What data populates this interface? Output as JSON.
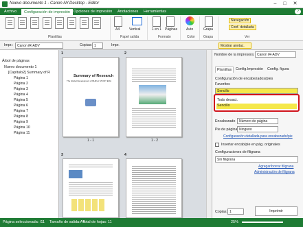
{
  "window": {
    "title": "Nuevo documento 1 - Canon iW Desktop - Editor",
    "minimize": "–",
    "maximize": "□",
    "close": "✕",
    "help": "?"
  },
  "ribbon_tabs": [
    "Archivo",
    "Configuración de impresión",
    "Opciones de impresión",
    "Anotaciones",
    "Herramientas"
  ],
  "ribbon": {
    "groups": {
      "plantillas": "Plantillas",
      "papel_salida": "Papel salida",
      "formato": "Formato",
      "color": "Color",
      "grapa": "Grapa",
      "ver": "Ver"
    },
    "paper_size": "A4",
    "orientation": "Vertical",
    "layout": "1 en 1",
    "order": "Páginas",
    "color_mode": "Auto",
    "staple": "Grapa",
    "navigation": "Navegación",
    "detailed_config": "Conf. detallada"
  },
  "toolbar2": {
    "printer_label": "Impr.:",
    "printer_value": "Canon iR-ADV",
    "copies_label": "Copias:",
    "copies_value": "1",
    "print_button": "Impr.",
    "zoom_label": "Mostrar anotac."
  },
  "tree": {
    "header": "Árbol de páginas",
    "root": "Nuevo documento 1",
    "chapter": "[Capítulo2] Summary of R",
    "pages": [
      "Página 1",
      "Página 2",
      "Página 3",
      "Página 4",
      "Página 5",
      "Página 6",
      "Página 7",
      "Página 8",
      "Página 9",
      "Página 10",
      "Página 11"
    ]
  },
  "pages": [
    {
      "num": "1",
      "caption": "1 - 1",
      "heading": "Summary of Research",
      "sub": "The Global Development of BHR at STUDY ERA"
    },
    {
      "num": "2",
      "caption": "1 - 2"
    },
    {
      "num": "3",
      "caption": ""
    },
    {
      "num": "4",
      "caption": ""
    }
  ],
  "right_panel": {
    "printer_label": "Nombre de la impresora:",
    "printer_value": "Canon iR-ADV",
    "tabs": [
      "Plantillas",
      "Config.Impresión",
      "Config. figura"
    ],
    "section_title": "Configuración de encabezados/pies",
    "favorites_label": "Favoritos",
    "favorites_value": "Sencillo",
    "dropdown_options": [
      "Todo desact.",
      "Sencillo"
    ],
    "header_label": "Encabezado",
    "header_value": "Número de página",
    "footer_label": "Pie de página",
    "footer_value": "Ninguno",
    "detail_link": "Configuración detallada para encabezado/pie",
    "insert_label": "Insertar encab/pie en pág. originales",
    "watermark_title": "Configuraciones de filigrana",
    "watermark_value": "Sin filigrana",
    "add_watermark": "Agregar/borrar filigrana",
    "manage_watermark": "Administración de filigrana",
    "copies_label": "Copias:",
    "copies_value": "1",
    "print_button": "Imprimir"
  },
  "statusbar": {
    "selected": "Página seleccionada: /11",
    "paper_size": "Tamaño de salida:A4",
    "total": "Total de hojas: 11",
    "zoom": "25%"
  },
  "colors": {
    "accent": "#1e7b34",
    "highlight_border": "#d0121b",
    "highlight_fill": "#f5e84a"
  }
}
